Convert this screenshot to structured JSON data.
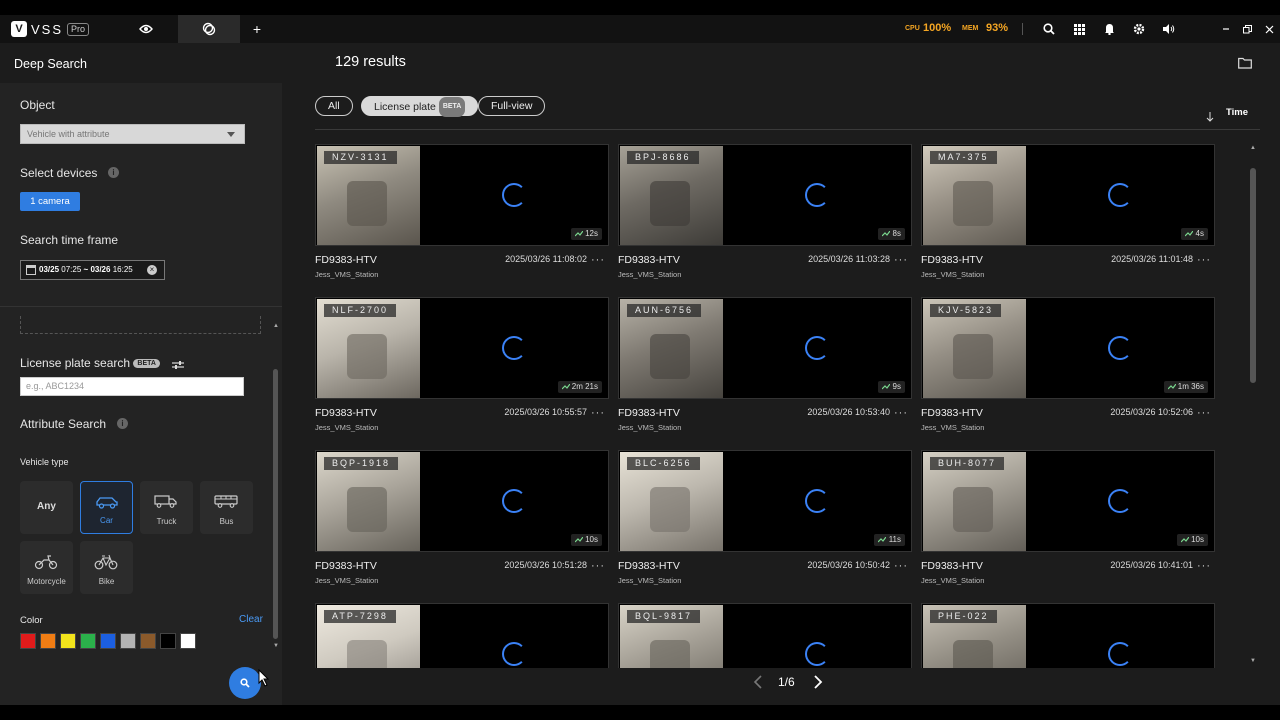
{
  "topbar": {
    "brand": "VSS",
    "pro": "Pro",
    "logo_letter": "V",
    "cpu_label": "CPU",
    "cpu_value": "100%",
    "mem_label": "MEM",
    "mem_value": "93%",
    "add_tab": "+",
    "accent_color": "#f5a623"
  },
  "header": {
    "title": "Deep Search",
    "results": "129 results"
  },
  "sidebar": {
    "object_label": "Object",
    "object_value": "Vehicle with attribute",
    "devices_label": "Select devices",
    "camera_button": "1 camera",
    "timeframe_label": "Search time frame",
    "timeframe_from": "03/25",
    "timeframe_from_time": "07:25",
    "timeframe_sep": "~",
    "timeframe_to": "03/26",
    "timeframe_to_time": "16:25",
    "lp_label": "License plate search",
    "lp_beta": "BETA",
    "lp_placeholder": "e.g., ABC1234",
    "attr_label": "Attribute Search",
    "vehicle_type_label": "Vehicle type",
    "vehicle_types": [
      {
        "label": "Any",
        "icon": "any",
        "selected": false
      },
      {
        "label": "Car",
        "icon": "car-icon",
        "selected": true
      },
      {
        "label": "Truck",
        "icon": "truck-icon",
        "selected": false
      },
      {
        "label": "Bus",
        "icon": "bus-icon",
        "selected": false
      },
      {
        "label": "Motorcycle",
        "icon": "motorcycle-icon",
        "selected": false
      },
      {
        "label": "Bike",
        "icon": "bike-icon",
        "selected": false
      }
    ],
    "color_label": "Color",
    "clear_label": "Clear",
    "colors": [
      "#e01b1b",
      "#f07d14",
      "#f2e41c",
      "#2bb14b",
      "#1c5fe0",
      "#b3b3b3",
      "#8b5a2b",
      "#000000",
      "#ffffff"
    ]
  },
  "filters": {
    "all": "All",
    "license_plate": "License plate",
    "license_plate_beta": "BETA",
    "full_view": "Full-view",
    "sort_label": "Time"
  },
  "results": [
    {
      "plate": "NZV-3131",
      "name": "FD9383-HTV",
      "time": "2025/03/26 11:08:02",
      "station": "Jess_VMS_Station",
      "duration": "12s"
    },
    {
      "plate": "BPJ-8686",
      "name": "FD9383-HTV",
      "time": "2025/03/26 11:03:28",
      "station": "Jess_VMS_Station",
      "duration": "8s"
    },
    {
      "plate": "MA7-375",
      "name": "FD9383-HTV",
      "time": "2025/03/26 11:01:48",
      "station": "Jess_VMS_Station",
      "duration": "4s"
    },
    {
      "plate": "NLF-2700",
      "name": "FD9383-HTV",
      "time": "2025/03/26 10:55:57",
      "station": "Jess_VMS_Station",
      "duration": "2m 21s"
    },
    {
      "plate": "AUN-6756",
      "name": "FD9383-HTV",
      "time": "2025/03/26 10:53:40",
      "station": "Jess_VMS_Station",
      "duration": "9s"
    },
    {
      "plate": "KJV-5823",
      "name": "FD9383-HTV",
      "time": "2025/03/26 10:52:06",
      "station": "Jess_VMS_Station",
      "duration": "1m 36s"
    },
    {
      "plate": "BQP-1918",
      "name": "FD9383-HTV",
      "time": "2025/03/26 10:51:28",
      "station": "Jess_VMS_Station",
      "duration": "10s"
    },
    {
      "plate": "BLC-6256",
      "name": "FD9383-HTV",
      "time": "2025/03/26 10:50:42",
      "station": "Jess_VMS_Station",
      "duration": "11s"
    },
    {
      "plate": "BUH-8077",
      "name": "FD9383-HTV",
      "time": "2025/03/26 10:41:01",
      "station": "Jess_VMS_Station",
      "duration": "10s"
    },
    {
      "plate": "ATP-7298",
      "name": "",
      "time": "",
      "station": "",
      "duration": ""
    },
    {
      "plate": "BQL-9817",
      "name": "",
      "time": "",
      "station": "",
      "duration": ""
    },
    {
      "plate": "PHE-022",
      "name": "",
      "time": "",
      "station": "",
      "duration": ""
    }
  ],
  "pagination": {
    "current": "1/6"
  }
}
